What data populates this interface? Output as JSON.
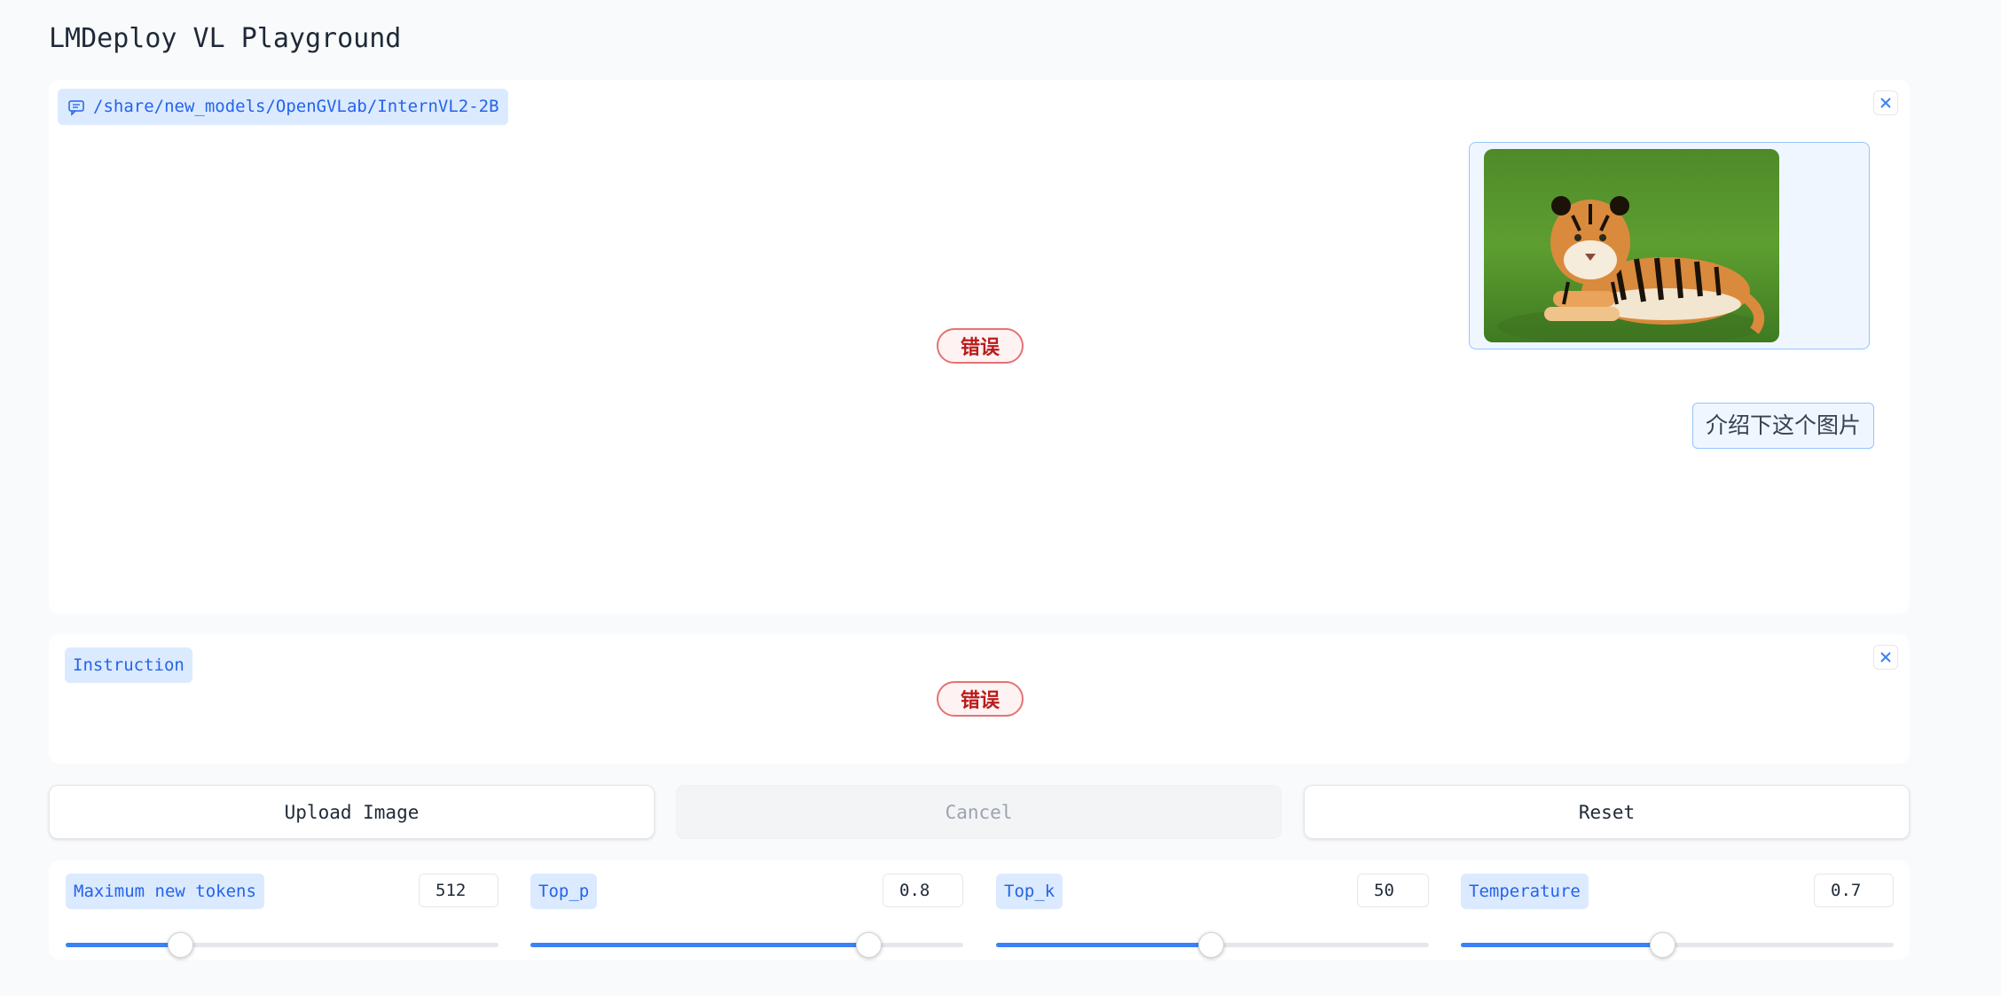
{
  "app": {
    "title": "LMDeploy VL Playground"
  },
  "chatbot": {
    "label": "/share/new_models/OpenGVLab/InternVL2-2B",
    "error_text": "错误",
    "user_message_text": "介绍下这个图片"
  },
  "instruction": {
    "label": "Instruction",
    "error_text": "错误"
  },
  "actions": {
    "upload_label": "Upload Image",
    "cancel_label": "Cancel",
    "reset_label": "Reset"
  },
  "sliders": [
    {
      "label": "Maximum new tokens",
      "value": "512",
      "fraction": 0.265
    },
    {
      "label": "Top_p",
      "value": "0.8",
      "fraction": 0.781
    },
    {
      "label": "Top_k",
      "value": "50",
      "fraction": 0.495
    },
    {
      "label": "Temperature",
      "value": "0.7",
      "fraction": 0.465
    }
  ],
  "colors": {
    "accent": "#3b82f6",
    "label_bg": "#dbeafe",
    "label_text": "#2563eb",
    "error_border": "#e57373",
    "error_text": "#b91c1c"
  }
}
